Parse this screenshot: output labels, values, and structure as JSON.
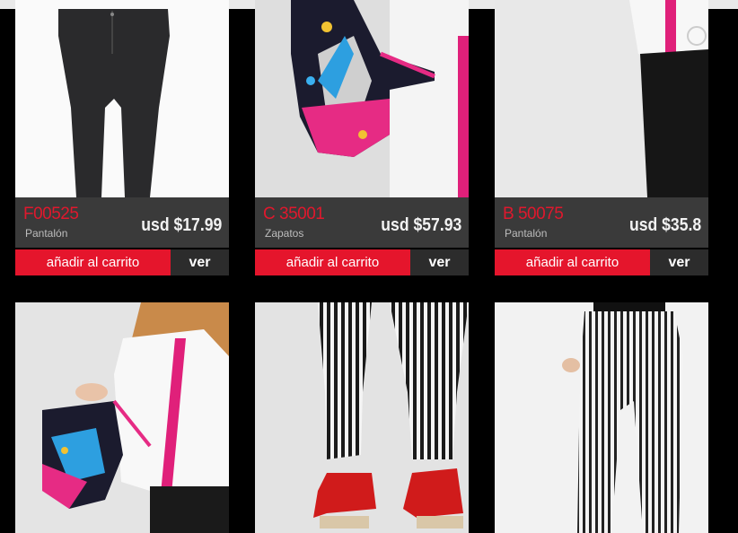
{
  "products": [
    {
      "code": "F00525",
      "category": "Pantalón",
      "price": "usd $17.99",
      "add_label": "añadir al carrito",
      "view_label": "ver",
      "image": "black-leggings-photo"
    },
    {
      "code": "C 35001",
      "category": "Zapatos",
      "price": "usd $57.93",
      "add_label": "añadir al carrito",
      "view_label": "ver",
      "image": "pink-printed-heel-photo"
    },
    {
      "code": "B 50075",
      "category": "Pantalón",
      "price": "usd $35.8",
      "add_label": "añadir al carrito",
      "view_label": "ver",
      "image": "black-pants-photo"
    },
    {
      "image": "model-holding-heel-photo"
    },
    {
      "image": "striped-pants-red-heels-photo"
    },
    {
      "image": "striped-pants-model-photo"
    }
  ],
  "colors": {
    "accent": "#e5152c",
    "code_red": "#e0182d",
    "info_bg": "#3a3a3a",
    "view_bg": "#2c2c2c",
    "page_bg": "#000000"
  }
}
